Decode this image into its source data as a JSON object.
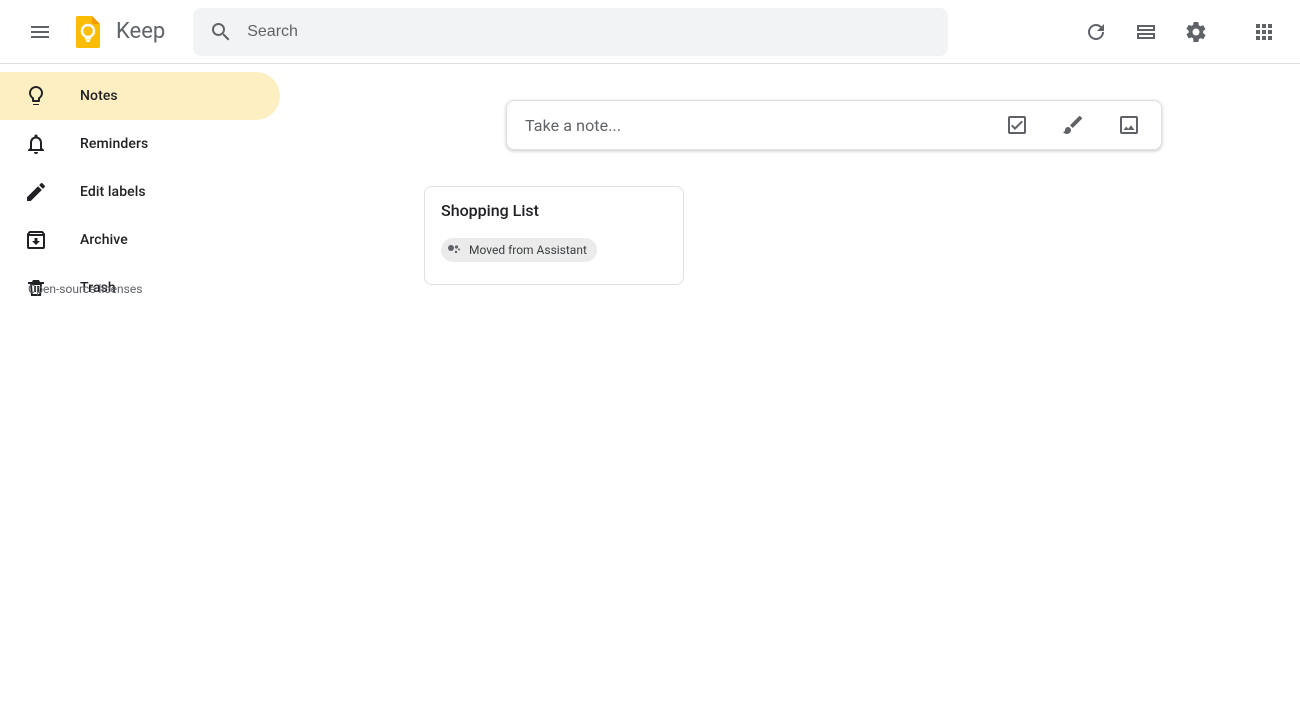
{
  "header": {
    "app_name": "Keep",
    "search_placeholder": "Search"
  },
  "sidebar": {
    "items": [
      {
        "label": "Notes"
      },
      {
        "label": "Reminders"
      },
      {
        "label": "Edit labels"
      },
      {
        "label": "Archive"
      },
      {
        "label": "Trash"
      }
    ],
    "licenses_label": "Open-source licenses"
  },
  "compose": {
    "placeholder": "Take a note..."
  },
  "notes": [
    {
      "title": "Shopping List",
      "chip_label": "Moved from Assistant"
    }
  ]
}
